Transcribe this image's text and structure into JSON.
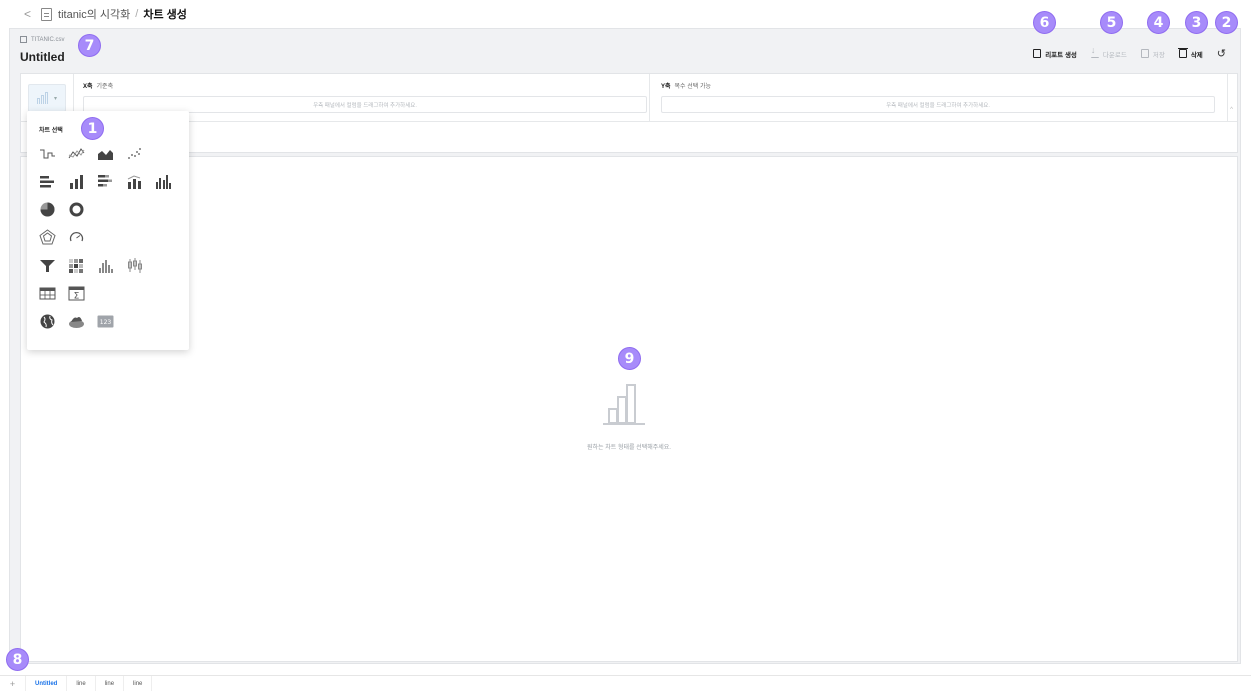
{
  "breadcrumb": {
    "project": "titanic의 시각화",
    "separator": "/",
    "current": "차트 생성"
  },
  "header": {
    "dataset": "TITANIC.csv",
    "title": "Untitled"
  },
  "actions": {
    "report": "리포트 생성",
    "download": "다운로드",
    "save": "저장",
    "delete": "삭제"
  },
  "config": {
    "x_axis_label": "X축",
    "x_axis_sub": "기준축",
    "x_placeholder": "우측 패널에서 컬럼을 드래그하여 추가하세요.",
    "y_axis_label": "Y축",
    "y_axis_sub": "복수 선택 가능",
    "y_placeholder": "우측 패널에서 컬럼을 드래그하여 추가하세요."
  },
  "picker": {
    "title": "차트 선택",
    "number_icon_text": "123"
  },
  "canvas": {
    "empty_message": "원하는 차트 형태를 선택해주세요."
  },
  "tabs": [
    "Untitled",
    "line",
    "line",
    "line"
  ],
  "badges": [
    "1",
    "2",
    "3",
    "4",
    "5",
    "6",
    "7",
    "8",
    "9"
  ],
  "colors": {
    "accent": "#1a73e8",
    "badge": "#a78bfa",
    "icon_dark": "#555555",
    "icon_light": "#b8bcc2"
  }
}
